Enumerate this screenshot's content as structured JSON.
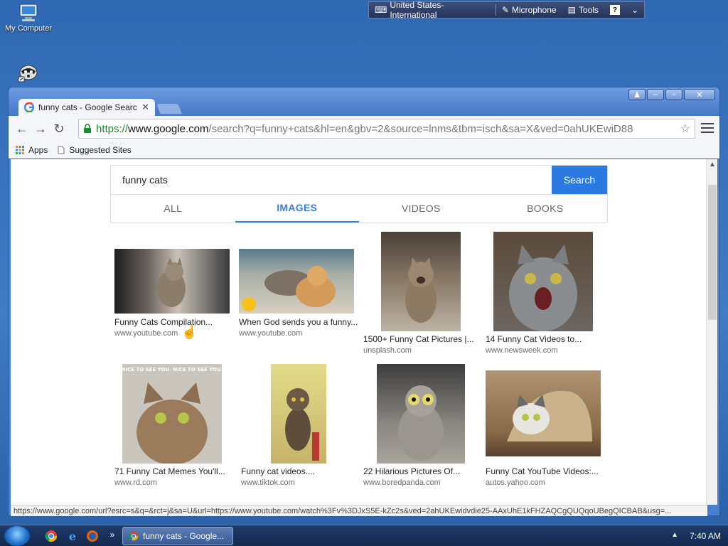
{
  "desktop": {
    "icons": [
      {
        "label": "My Computer",
        "icon": "computer-icon"
      },
      {
        "label": "",
        "icon": "raccoon-icon"
      }
    ]
  },
  "langbar": {
    "language": "United States-International",
    "microphone": "Microphone",
    "tools": "Tools",
    "help": "?"
  },
  "browser": {
    "tab_title": "funny cats - Google Search",
    "url_scheme": "https://",
    "url_host": "www.google.com",
    "url_path": "/search?q=funny+cats&hl=en&gbv=2&source=lnms&tbm=isch&sa=X&ved=0ahUKEwiD88",
    "bookmarks": [
      {
        "label": "Apps",
        "icon": "apps-grid-icon"
      },
      {
        "label": "Suggested Sites",
        "icon": "page-icon"
      }
    ],
    "status_url": "https://www.google.com/url?esrc=s&q=&rct=j&sa=U&url=https://www.youtube.com/watch%3Fv%3DJxS5E-kZc2s&ved=2ahUKEwidvdie25-AAxUhE1kFHZAQCgQUQqoUBegQICBAB&usg=..."
  },
  "search": {
    "query": "funny cats",
    "button": "Search",
    "tabs": [
      "ALL",
      "IMAGES",
      "VIDEOS",
      "BOOKS"
    ],
    "active_tab": "IMAGES"
  },
  "results": [
    {
      "caption": "Funny Cats Compilation...",
      "source": "www.youtube.com"
    },
    {
      "caption": "When God sends you a funny...",
      "source": "www.youtube.com"
    },
    {
      "caption": "1500+ Funny Cat Pictures |...",
      "source": "unsplash.com"
    },
    {
      "caption": "14 Funny Cat Videos to...",
      "source": "www.newsweek.com"
    },
    {
      "caption": "71 Funny Cat Memes You'll...",
      "source": "www.rd.com"
    },
    {
      "caption": "Funny cat videos....",
      "source": "www.tiktok.com"
    },
    {
      "caption": "22 Hilarious Pictures Of...",
      "source": "www.boredpanda.com"
    },
    {
      "caption": "Funny Cat YouTube Videos:...",
      "source": "autos.yahoo.com"
    }
  ],
  "meme_text": "NICE TO SEE YOU. NICE TO SEE YOU.",
  "taskbar": {
    "task_label": "funny cats - Google...",
    "clock": "7:40 AM"
  },
  "colors": {
    "accent": "#2a7ae2",
    "active_tab": "#3b7ddd",
    "secure": "#1a8a2a"
  }
}
